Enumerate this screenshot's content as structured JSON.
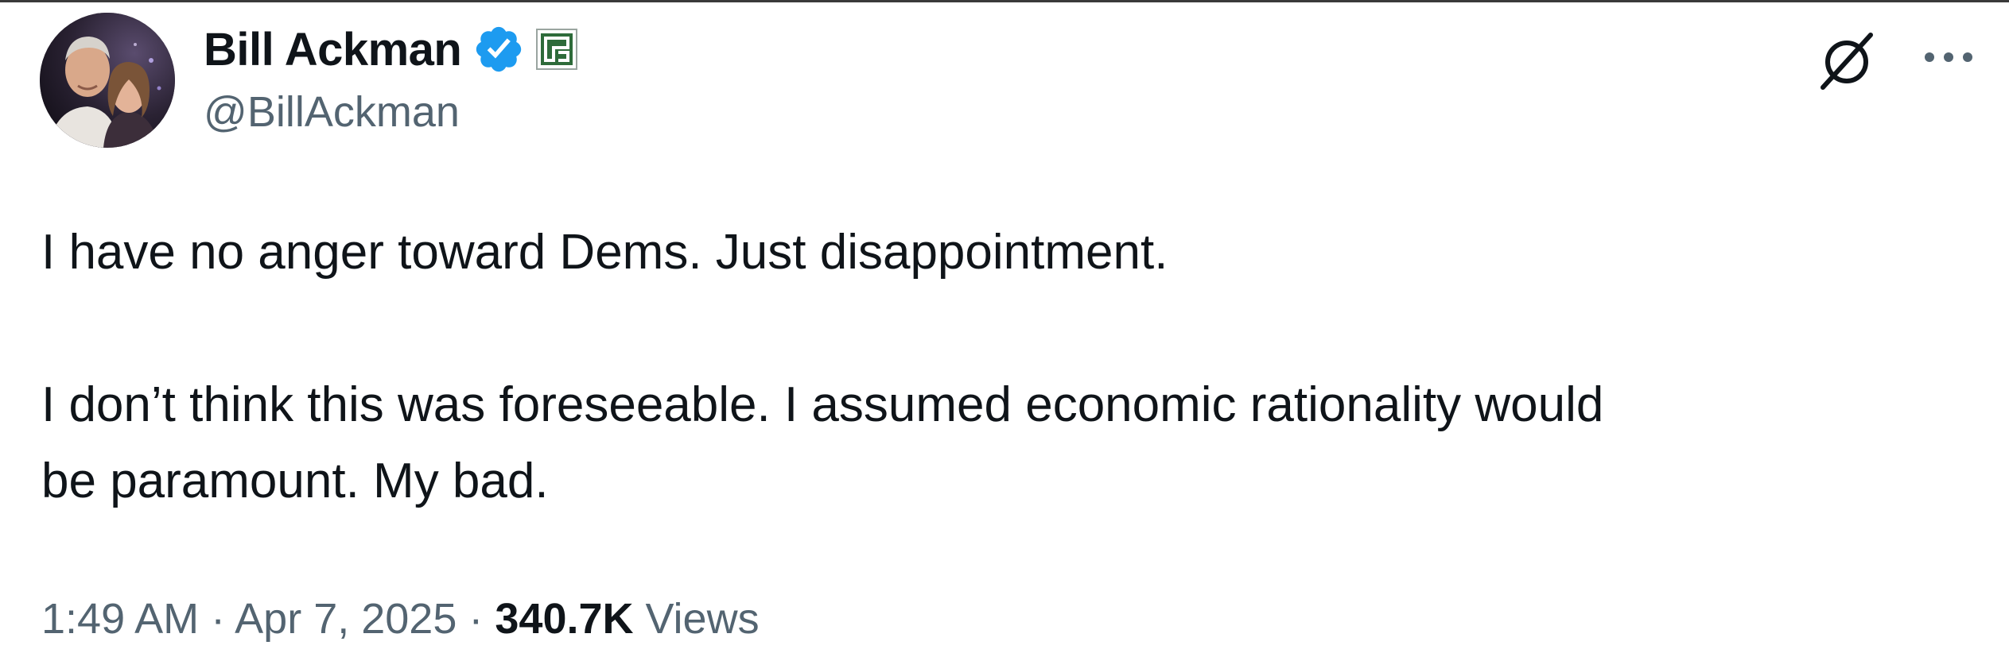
{
  "author": {
    "display_name": "Bill Ackman",
    "handle": "@BillAckman",
    "verified": true,
    "affiliate_badge": "pershing-square-badge"
  },
  "tweet": {
    "paragraph_1": "I have no anger toward Dems. Just disappointment.",
    "paragraph_2_line_1": "I don’t think this was foreseeable. I assumed economic rationality would",
    "paragraph_2_line_2": "be paramount. My bad.",
    "time": "1:49 AM",
    "separator": "·",
    "date": "Apr 7, 2025",
    "views_count": "340.7K",
    "views_label": "Views"
  },
  "icons": {
    "verified": "verified-check-icon",
    "grok": "grok-icon",
    "more": "more-options-icon"
  },
  "colors": {
    "verified_blue": "#1d9bf0",
    "badge_green": "#2e6b3a",
    "text_primary": "#0f1419",
    "text_secondary": "#536471"
  }
}
